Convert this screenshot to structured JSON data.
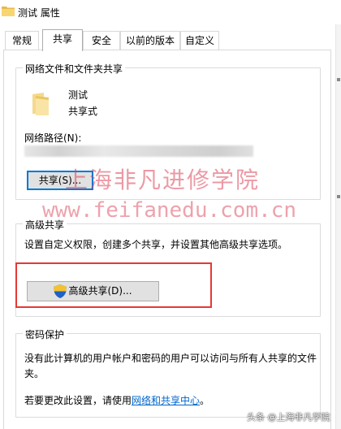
{
  "window": {
    "title": "测试 属性"
  },
  "tabs": [
    {
      "label": "常规",
      "active": false
    },
    {
      "label": "共享",
      "active": true
    },
    {
      "label": "安全",
      "active": false
    },
    {
      "label": "以前的版本",
      "active": false
    },
    {
      "label": "自定义",
      "active": false
    }
  ],
  "network_share": {
    "group_title": "网络文件和文件夹共享",
    "folder_name": "测试",
    "status": "共享式",
    "path_label": "网络路径(N):",
    "path_value": "",
    "share_button": "共享(S)..."
  },
  "advanced_share": {
    "group_title": "高级共享",
    "description": "设置自定义权限，创建多个共享，并设置其他高级共享选项。",
    "button": "高级共享(D)..."
  },
  "password_protection": {
    "group_title": "密码保护",
    "description": "没有此计算机的用户帐户和密码的用户可以访问与所有人共享的文件夹。",
    "change_prefix": "若要更改此设置，请使用",
    "link": "网络和共享中心",
    "change_suffix": "。"
  },
  "watermark": {
    "text_cn": "上海非凡进修学院",
    "text_url": "www.feifanedu.com.cn",
    "badge": "头条 @上海非凡学院"
  },
  "colors": {
    "highlight_border": "#e53935",
    "link": "#0066cc",
    "focus_border": "#0078d7"
  }
}
